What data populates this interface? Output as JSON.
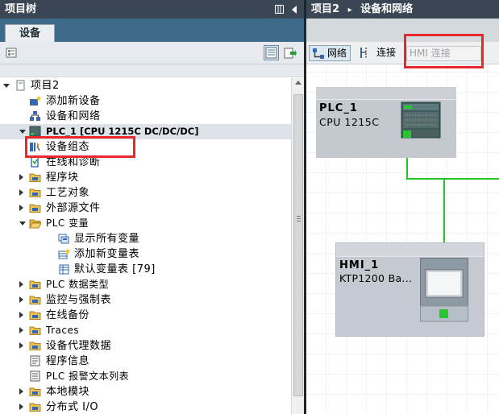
{
  "project_tree": {
    "title": "项目树",
    "tab": "设备",
    "items": [
      {
        "label": "项目2",
        "level": 0,
        "expand": "expanded",
        "icon": "project-icon"
      },
      {
        "label": "添加新设备",
        "level": 1,
        "expand": "none",
        "icon": "add-device-icon"
      },
      {
        "label": "设备和网络",
        "level": 1,
        "expand": "none",
        "icon": "network-icon"
      },
      {
        "label": "PLC_1 [CPU 1215C DC/DC/DC]",
        "level": 1,
        "expand": "expanded",
        "icon": "plc-icon"
      },
      {
        "label": "设备组态",
        "level": 2,
        "expand": "none",
        "icon": "device-config-icon"
      },
      {
        "label": "在线和诊断",
        "level": 2,
        "expand": "none",
        "icon": "online-diagnostics-icon"
      },
      {
        "label": "程序块",
        "level": 2,
        "expand": "collapsed",
        "icon": "folder-icon"
      },
      {
        "label": "工艺对象",
        "level": 2,
        "expand": "collapsed",
        "icon": "folder-icon"
      },
      {
        "label": "外部源文件",
        "level": 2,
        "expand": "collapsed",
        "icon": "folder-icon"
      },
      {
        "label": "PLC 变量",
        "level": 2,
        "expand": "expanded",
        "icon": "folder-open-icon"
      },
      {
        "label": "显示所有变量",
        "level": 3,
        "expand": "none",
        "icon": "show-tags-icon"
      },
      {
        "label": "添加新变量表",
        "level": 3,
        "expand": "none",
        "icon": "add-tag-table-icon"
      },
      {
        "label": "默认变量表 [79]",
        "level": 3,
        "expand": "none",
        "icon": "tag-table-icon"
      },
      {
        "label": "PLC 数据类型",
        "level": 2,
        "expand": "collapsed",
        "icon": "folder-icon"
      },
      {
        "label": "监控与强制表",
        "level": 2,
        "expand": "collapsed",
        "icon": "folder-icon"
      },
      {
        "label": "在线备份",
        "level": 2,
        "expand": "collapsed",
        "icon": "folder-icon"
      },
      {
        "label": "Traces",
        "level": 2,
        "expand": "collapsed",
        "icon": "folder-icon"
      },
      {
        "label": "设备代理数据",
        "level": 2,
        "expand": "collapsed",
        "icon": "folder-icon"
      },
      {
        "label": "程序信息",
        "level": 2,
        "expand": "none",
        "icon": "program-info-icon"
      },
      {
        "label": "PLC 报警文本列表",
        "level": 2,
        "expand": "none",
        "icon": "alarm-text-icon"
      },
      {
        "label": "本地模块",
        "level": 2,
        "expand": "collapsed",
        "icon": "folder-icon"
      },
      {
        "label": "分布式 I/O",
        "level": 2,
        "expand": "collapsed",
        "icon": "folder-icon"
      }
    ]
  },
  "editor": {
    "breadcrumb_project": "项目2",
    "breadcrumb_sep": "▸",
    "breadcrumb_view": "设备和网络",
    "network_button": "网络",
    "connection_button": "连接",
    "hmi_select_value": "HMI 连接"
  },
  "devices": {
    "plc": {
      "name": "PLC_1",
      "type": "CPU 1215C"
    },
    "hmi": {
      "name": "HMI_1",
      "type": "KTP1200 Ba..."
    }
  },
  "colors": {
    "title_bar": "#3a4653",
    "tab_bar": "#3e6b8a",
    "profinet_green": "#21c42b",
    "highlight_red": "#e8282a"
  }
}
